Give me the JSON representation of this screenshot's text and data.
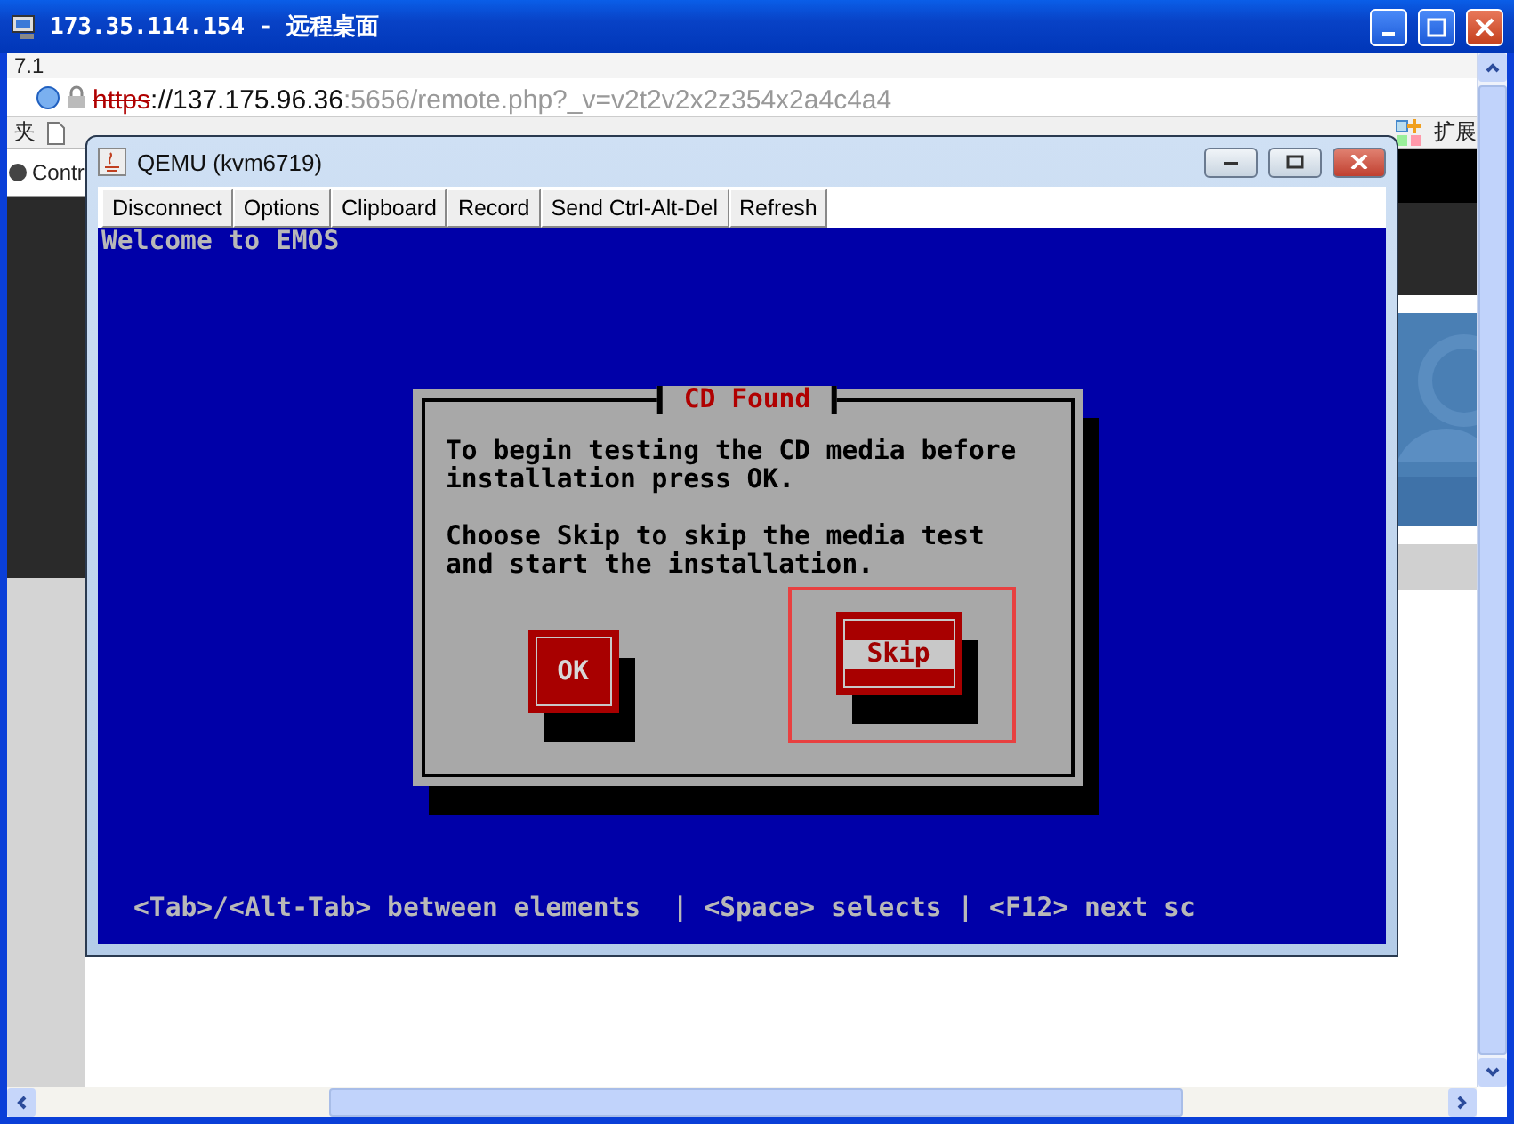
{
  "window": {
    "title": "173.35.114.154 - 远程桌面"
  },
  "browser": {
    "version_text": "7.1",
    "address": {
      "scheme": "https",
      "host": "://137.175.96.36",
      "path": ":5656/remote.php?_v=v2t2v2x2z354x2a4c4a4"
    },
    "bookmark_text": "夹",
    "extensions_label": "扩展",
    "sidebar_text": "Contr"
  },
  "vm_window": {
    "title": "QEMU (kvm6719)",
    "toolbar": [
      "Disconnect",
      "Options",
      "Clipboard",
      "Record",
      "Send Ctrl-Alt-Del",
      "Refresh"
    ],
    "console": {
      "top_line": "Welcome to EMOS",
      "dialog": {
        "title": "CD Found",
        "paragraphs": [
          "To begin testing the CD media before installation press OK.",
          "Choose Skip to skip the media test and start the installation."
        ],
        "buttons": [
          {
            "label": "OK",
            "focused": false,
            "highlighted": false
          },
          {
            "label": "Skip",
            "focused": true,
            "highlighted": true
          }
        ]
      },
      "help_line": "<Tab>/<Alt-Tab> between elements  | <Space> selects | <F12> next sc"
    }
  }
}
